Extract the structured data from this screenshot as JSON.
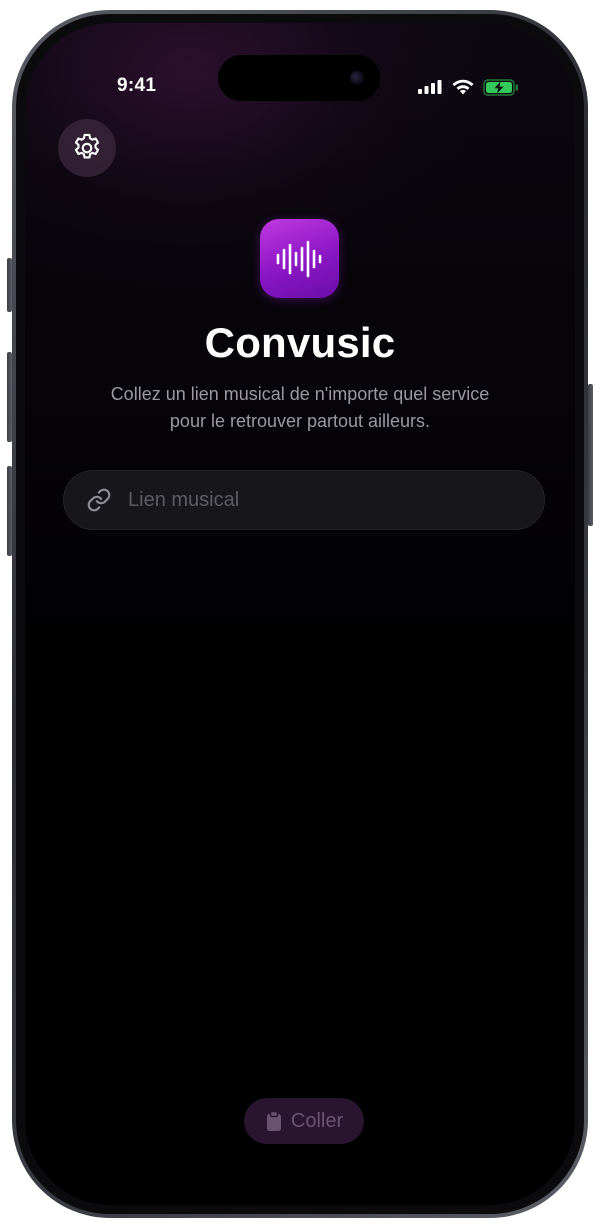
{
  "status_bar": {
    "time": "9:41",
    "icons": [
      "cellular-signal-icon",
      "wifi-icon",
      "battery-charging-icon"
    ]
  },
  "header": {
    "settings_icon": "gear-icon"
  },
  "app": {
    "icon": "waveform-icon",
    "title": "Convusic",
    "subtitle": "Collez un lien musical de n'importe quel service pour le retrouver partout ailleurs."
  },
  "link_input": {
    "icon": "link-icon",
    "placeholder": "Lien musical",
    "value": ""
  },
  "paste_button": {
    "icon": "clipboard-icon",
    "label": "Coller"
  },
  "colors": {
    "accent": "#9a22d0",
    "battery": "#34c759",
    "background": "#000000"
  }
}
